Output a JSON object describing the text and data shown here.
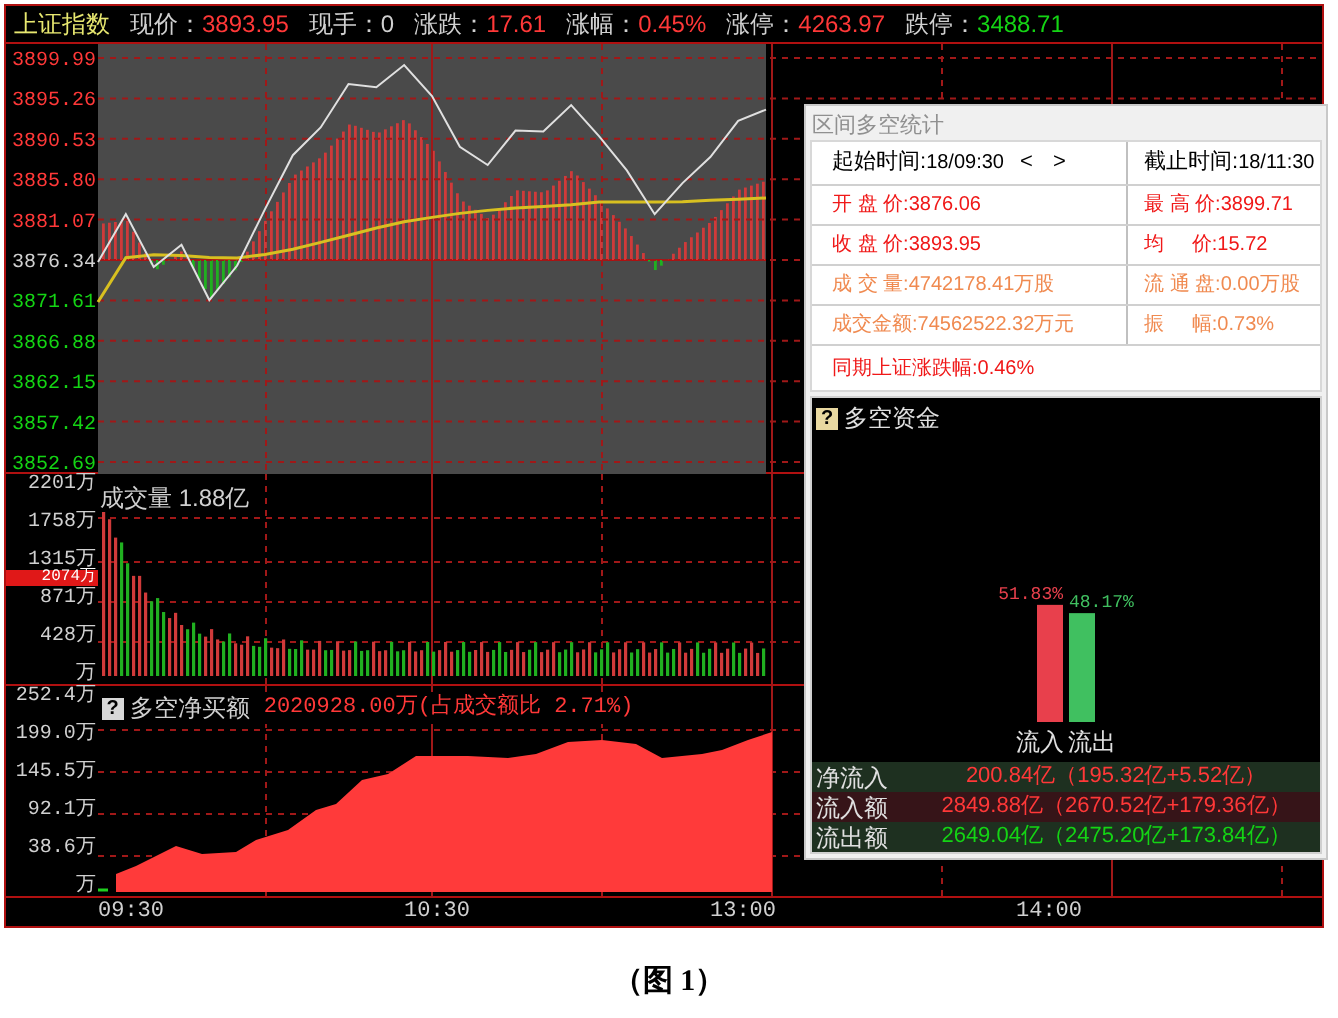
{
  "header": {
    "title": "上证指数",
    "fields": [
      {
        "label": "现价：",
        "value": "3893.95",
        "kind": "up"
      },
      {
        "label": "现手：",
        "value": "0",
        "kind": "plain"
      },
      {
        "label": "涨跌：",
        "value": "17.61",
        "kind": "up"
      },
      {
        "label": "涨幅：",
        "value": "0.45%",
        "kind": "up"
      },
      {
        "label": "涨停：",
        "value": "4263.97",
        "kind": "up"
      },
      {
        "label": "跌停：",
        "value": "3488.71",
        "kind": "down"
      }
    ]
  },
  "price_chart": {
    "chart_data": {
      "type": "line",
      "categories": [
        null,
        null,
        null,
        null,
        null,
        null,
        null,
        null,
        null,
        null,
        null,
        null,
        null,
        null,
        null,
        null,
        null,
        null,
        null,
        null,
        null,
        null,
        null,
        null,
        null
      ],
      "ylim": [
        3852.69,
        3899.99
      ],
      "yticks": [
        {
          "value": 3899.99,
          "label": "3899.99"
        },
        {
          "value": 3895.26,
          "label": "3895.26"
        },
        {
          "value": 3890.53,
          "label": "3890.53"
        },
        {
          "value": 3885.8,
          "label": "3885.80"
        },
        {
          "value": 3881.07,
          "label": "3881.07"
        },
        {
          "value": 3876.34,
          "label": "3876.34"
        },
        {
          "value": 3871.61,
          "label": "3871.61"
        },
        {
          "value": 3866.88,
          "label": "3866.88"
        },
        {
          "value": 3862.15,
          "label": "3862.15"
        },
        {
          "value": 3857.42,
          "label": "3857.42"
        },
        {
          "value": 3852.69,
          "label": "3852.69"
        }
      ],
      "grid": true,
      "series": [
        {
          "color": "#e0e0e0",
          "values": [
            3876.11,
            3881.73,
            3875.53,
            3878.12,
            3871.65,
            3875.69,
            3882.3,
            3888.61,
            3891.86,
            3896.94,
            3896.56,
            3899.16,
            3895.54,
            3889.6,
            3887.46,
            3891.5,
            3891.39,
            3894.48,
            3890.85,
            3886.83,
            3881.7,
            3885.34,
            3888.4,
            3892.63,
            3893.95
          ]
        },
        {
          "color": "#d8c020",
          "values": [
            3871.42,
            3876.6,
            3876.95,
            3876.86,
            3876.63,
            3876.57,
            3876.99,
            3877.6,
            3878.4,
            3879.24,
            3880.08,
            3880.82,
            3881.33,
            3881.8,
            3882.15,
            3882.43,
            3882.61,
            3882.8,
            3883.13,
            3883.13,
            3883.13,
            3883.16,
            3883.34,
            3883.45,
            3883.6
          ]
        }
      ]
    }
  },
  "volume_panel": {
    "title": "成交量 1.88亿",
    "axis": [
      "2201万",
      "1758万",
      "1315万",
      "871万",
      "428万",
      "万"
    ],
    "cursor_label": "2074万"
  },
  "time_axis": [
    "09:30",
    "10:30",
    "13:00",
    "14:00"
  ],
  "net_buy_panel": {
    "help": "?",
    "title": "多空净买额",
    "value": "2020928.00万(占成交额比 2.71%)",
    "axis": [
      "252.4万",
      "199.0万",
      "145.5万",
      "92.1万",
      "38.6万",
      "万"
    ]
  },
  "popup": {
    "title": "区间多空统计",
    "start_label": "起始时间:",
    "start_value": "18/09:30",
    "nav": [
      "<",
      ">"
    ],
    "end_label": "截止时间:",
    "end_value": "18/11:30",
    "rows": [
      {
        "left": "开 盘 价:3876.06",
        "right": "最 高 价:3899.71",
        "kind": "red"
      },
      {
        "left": "收 盘 价:3893.95",
        "right": "均     价:15.72",
        "kind": "red"
      },
      {
        "left": "成 交 量:4742178.41万股",
        "right": "流 通 盘:0.00万股",
        "kind": "orange"
      },
      {
        "left": "成交金额:74562522.32万元",
        "right": "振     幅:0.73%",
        "kind": "orange"
      }
    ],
    "change": "同期上证涨跌幅:0.46%"
  },
  "fund_panel": {
    "help": "?",
    "title": "多空资金",
    "bars": [
      {
        "label": "流入",
        "value": "51.83%",
        "color": "#e8404c"
      },
      {
        "label": "流出",
        "value": "48.17%",
        "color": "#40c060"
      }
    ],
    "rows": [
      {
        "label": "净流入",
        "value": "200.84亿（195.32亿+5.52亿）",
        "kind": "up"
      },
      {
        "label": "流入额",
        "value": "2849.88亿（2670.52亿+179.36亿）",
        "kind": "up"
      },
      {
        "label": "流出额",
        "value": "2649.04亿（2475.20亿+173.84亿）",
        "kind": "down"
      }
    ]
  },
  "caption": "（图 1）"
}
